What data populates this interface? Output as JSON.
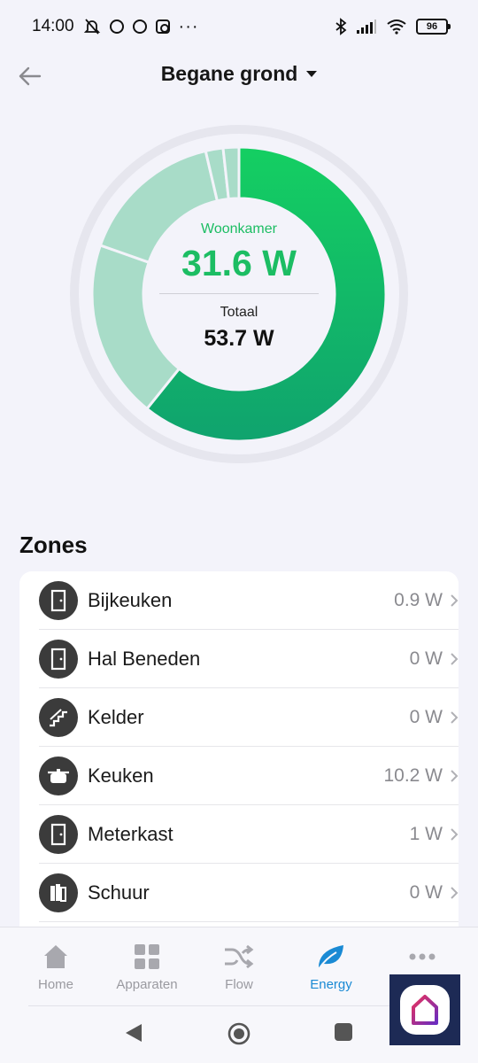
{
  "status_bar": {
    "time": "14:00",
    "battery": "96"
  },
  "header": {
    "title": "Begane grond"
  },
  "energy": {
    "selected_zone": "Woonkamer",
    "selected_power": "31.6 W",
    "total_label": "Totaal",
    "total_power": "53.7 W"
  },
  "zones_title": "Zones",
  "zones": [
    {
      "name": "Bijkeuken",
      "value": "0.9 W",
      "icon": "door-icon"
    },
    {
      "name": "Hal Beneden",
      "value": "0 W",
      "icon": "door-icon"
    },
    {
      "name": "Kelder",
      "value": "0 W",
      "icon": "stairs-icon"
    },
    {
      "name": "Keuken",
      "value": "10.2 W",
      "icon": "cooking-pot-icon"
    },
    {
      "name": "Meterkast",
      "value": "1 W",
      "icon": "door-icon"
    },
    {
      "name": "Schuur",
      "value": "0 W",
      "icon": "shed-icon"
    }
  ],
  "nav": {
    "items": [
      {
        "label": "Home",
        "icon": "home-icon"
      },
      {
        "label": "Apparaten",
        "icon": "devices-icon"
      },
      {
        "label": "Flow",
        "icon": "flow-icon"
      },
      {
        "label": "Energy",
        "icon": "leaf-icon"
      },
      {
        "label": "",
        "icon": "more-icon"
      }
    ],
    "active": "Energy"
  },
  "colors": {
    "accent_green": "#1cbd63",
    "active_blue": "#1a8ad4",
    "background": "#f3f3fa"
  },
  "chart_data": {
    "type": "pie",
    "segments": [
      {
        "name": "Woonkamer",
        "value": 31.6,
        "color": "#16c263"
      },
      {
        "name": "Keuken",
        "value": 10.2,
        "color": "#a8dcc8"
      },
      {
        "name": "segment-3",
        "value": 8.3,
        "color": "#a8dcc8"
      },
      {
        "name": "Meterkast",
        "value": 1.0,
        "color": "#a8dcc8"
      },
      {
        "name": "Bijkeuken",
        "value": 0.9,
        "color": "#a8dcc8"
      }
    ],
    "total": 53.7
  }
}
